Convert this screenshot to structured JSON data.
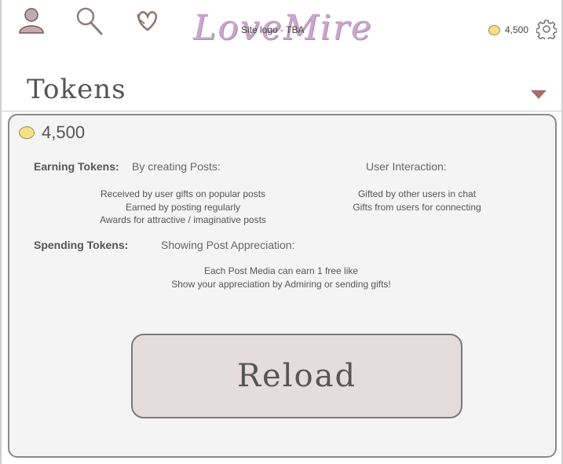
{
  "header": {
    "logo_text": "LoveMire",
    "logo_caption": "Site logo - TBA",
    "balance": "4,500",
    "icons": [
      "user-icon",
      "search-icon",
      "hearts-icon",
      "coin-icon",
      "gear-icon"
    ]
  },
  "page": {
    "title": "Tokens"
  },
  "panel": {
    "balance": "4,500",
    "earning": {
      "label": "Earning Tokens:",
      "posts_heading": "By creating Posts:",
      "posts_items": [
        "Received by user gifts on popular posts",
        "Earned by posting regularly",
        "Awards for attractive / imaginative posts"
      ],
      "interaction_heading": "User Interaction:",
      "interaction_items": [
        "Gifted by other users in chat",
        "Gifts from users for connecting"
      ]
    },
    "spending": {
      "label": "Spending Tokens:",
      "heading": "Showing Post Appreciation:",
      "items": [
        "Each Post Media can earn 1 free like",
        "Show your appreciation by Admiring or sending gifts!"
      ]
    },
    "reload_label": "Reload"
  },
  "colors": {
    "logo": "#c9a6cc",
    "coin": "#f7e08a",
    "caret": "#a86b6b",
    "reload_bg": "#e5dcdc",
    "panel_bg": "#f4f4f4"
  }
}
